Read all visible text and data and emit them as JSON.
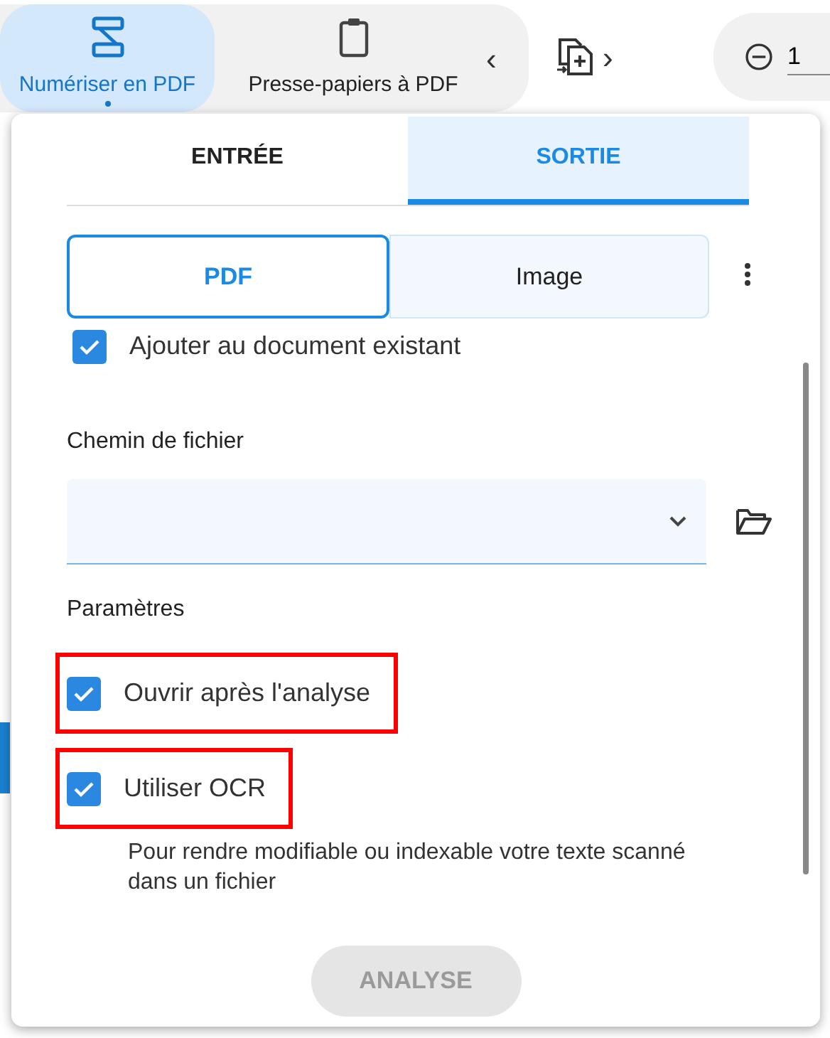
{
  "toolbar": {
    "modes": [
      {
        "label": "Numériser en PDF",
        "selected": true
      },
      {
        "label": "Presse-papiers à PDF",
        "selected": false
      }
    ],
    "prev": "‹",
    "next": "›",
    "zoom_value": "1"
  },
  "panel": {
    "tabs": [
      {
        "label": "ENTRÉE",
        "selected": false
      },
      {
        "label": "SORTIE",
        "selected": true
      }
    ],
    "formats": [
      {
        "label": "PDF",
        "selected": true
      },
      {
        "label": "Image",
        "selected": false
      }
    ],
    "append": {
      "label": "Ajouter au document existant",
      "checked": true
    },
    "path_label": "Chemin de fichier",
    "settings_label": "Paramètres",
    "options": [
      {
        "label": "Ouvrir après l'analyse",
        "checked": true,
        "highlighted": true
      },
      {
        "label": "Utiliser OCR",
        "checked": true,
        "highlighted": true,
        "hint": "Pour rendre modifiable ou indexable votre texte scanné dans un fichier"
      }
    ],
    "scan_button": {
      "label": "ANALYSE",
      "disabled": true
    }
  }
}
